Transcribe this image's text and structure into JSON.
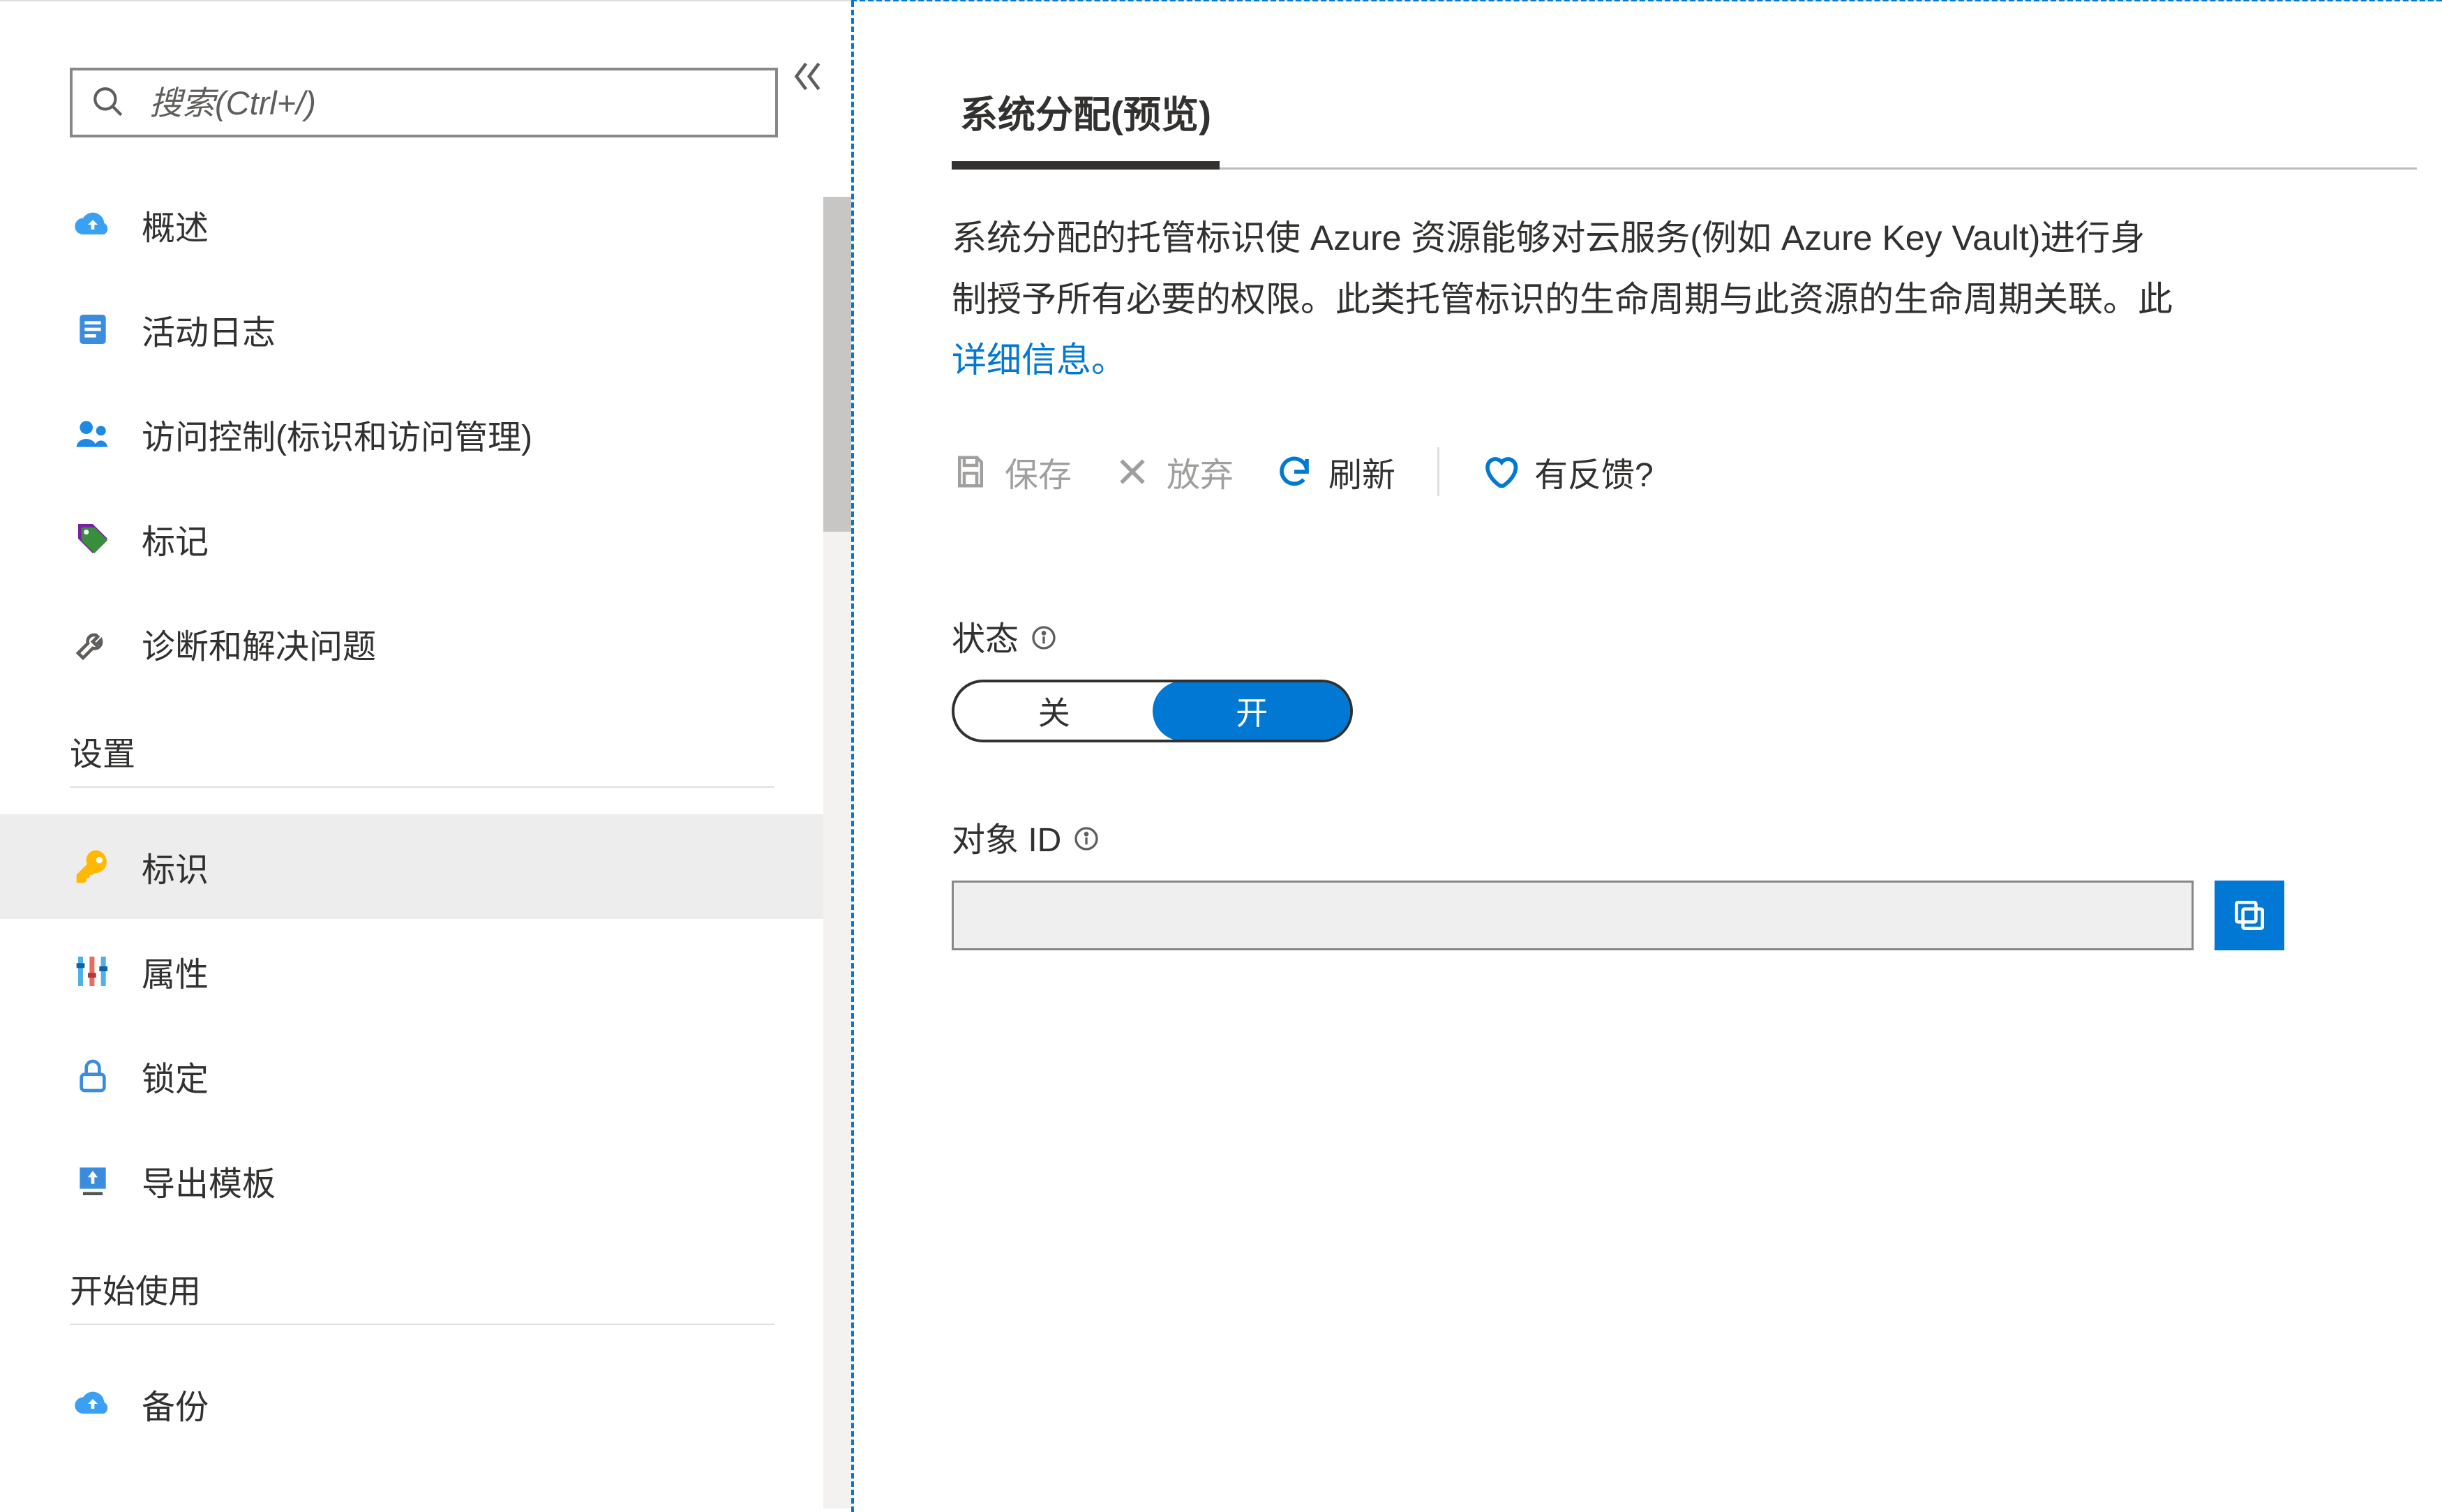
{
  "search": {
    "placeholder": "搜索(Ctrl+/)"
  },
  "sidebar": {
    "items": [
      {
        "label": "概述"
      },
      {
        "label": "活动日志"
      },
      {
        "label": "访问控制(标识和访问管理)"
      },
      {
        "label": "标记"
      },
      {
        "label": "诊断和解决问题"
      }
    ],
    "section_settings": "设置",
    "settings_items": [
      {
        "label": "标识"
      },
      {
        "label": "属性"
      },
      {
        "label": "锁定"
      },
      {
        "label": "导出模板"
      }
    ],
    "section_start": "开始使用",
    "start_items": [
      {
        "label": "备份"
      }
    ]
  },
  "main": {
    "tab_label": "系统分配(预览)",
    "desc_line1": "系统分配的托管标识使 Azure 资源能够对云服务(例如 Azure Key Vault)进行身",
    "desc_line2_a": "制授予所有必要的权限。此类托管标识的生命周期与此资源的生命周期关联。此",
    "desc_link": "详细信息。",
    "toolbar": {
      "save": "保存",
      "discard": "放弃",
      "refresh": "刷新",
      "feedback": "有反馈?"
    },
    "status": {
      "label": "状态",
      "off": "关",
      "on": "开"
    },
    "object_id": {
      "label": "对象 ID",
      "value": ""
    }
  }
}
